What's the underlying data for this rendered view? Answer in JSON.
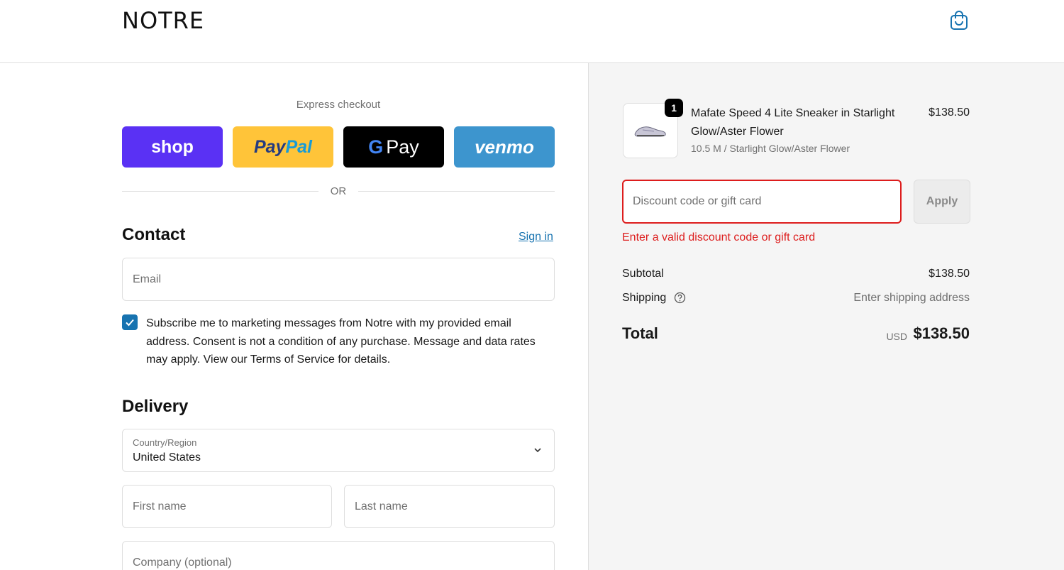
{
  "header": {
    "logo": "NOTRE"
  },
  "express": {
    "label": "Express checkout",
    "shop": "shop",
    "paypal_1": "Pay",
    "paypal_2": "Pal",
    "gpay_g": "G",
    "gpay_text": "Pay",
    "venmo": "venmo"
  },
  "or_text": "OR",
  "contact": {
    "title": "Contact",
    "sign_in": "Sign in",
    "email_placeholder": "Email",
    "consent": "Subscribe me to marketing messages from Notre with my provided email address. Consent is not a condition of any purchase. Message and data rates may apply. View our Terms of Service for details."
  },
  "delivery": {
    "title": "Delivery",
    "country_label": "Country/Region",
    "country_value": "United States",
    "first_name_placeholder": "First name",
    "last_name_placeholder": "Last name",
    "company_placeholder": "Company (optional)"
  },
  "summary": {
    "quantity": "1",
    "product_name": "Mafate Speed 4 Lite Sneaker in Starlight Glow/Aster Flower",
    "product_variant": "10.5 M / Starlight Glow/Aster Flower",
    "product_price": "$138.50",
    "discount_placeholder": "Discount code or gift card",
    "apply_label": "Apply",
    "discount_error": "Enter a valid discount code or gift card",
    "subtotal_label": "Subtotal",
    "subtotal_value": "$138.50",
    "shipping_label": "Shipping",
    "shipping_value": "Enter shipping address",
    "total_label": "Total",
    "currency": "USD",
    "total_value": "$138.50"
  },
  "colors": {
    "accent": "#1773b0",
    "error": "#dd1d1d",
    "shop": "#5a31f4",
    "paypal": "#ffc439",
    "venmo": "#3d95ce"
  },
  "icons": {
    "cart": "shopping-bag-icon",
    "checkbox": "check-icon",
    "chevron": "chevron-down-icon",
    "help": "question-circle-icon"
  }
}
